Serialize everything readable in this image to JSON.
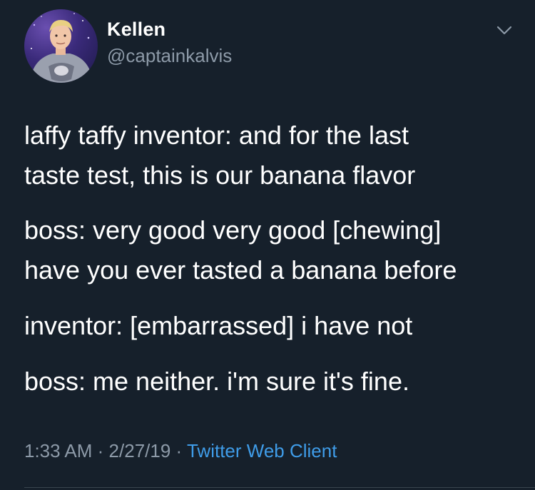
{
  "author": {
    "display_name": "Kellen",
    "handle": "@captainkalvis"
  },
  "tweet": {
    "paragraphs": [
      "laffy taffy inventor: and for the last taste test, this is our banana flavor",
      "boss: very good very good [chewing] have you ever tasted a banana before",
      "inventor: [embarrassed] i have not",
      "boss: me neither. i'm sure it's fine."
    ],
    "line_breaks": [
      [
        "laffy taffy inventor: and for the last",
        "taste test, this is our banana flavor"
      ],
      [
        "boss: very good very good [chewing]",
        "have you ever tasted a banana before"
      ]
    ]
  },
  "meta": {
    "time": "1:33 AM",
    "separator": "·",
    "date": "2/27/19",
    "source": "Twitter Web Client"
  },
  "icons": {
    "more_menu": "chevron-down-icon"
  },
  "colors": {
    "background": "#16202b",
    "text": "#ffffff",
    "secondary_text": "#8d9aa8",
    "link": "#3f9ce8"
  }
}
